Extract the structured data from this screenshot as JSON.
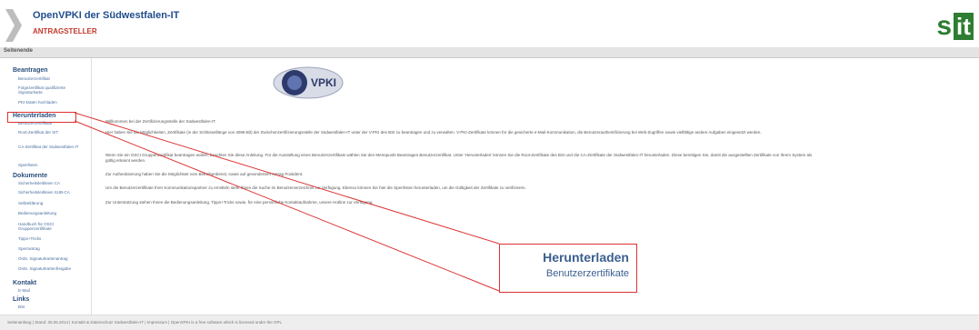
{
  "header": {
    "site_title": "OpenVPKI der Südwestfalen-IT",
    "role": "ANTRAGSTELLER",
    "logo_text": "sit"
  },
  "subbar": {
    "label": "Seitenende"
  },
  "sidebar": {
    "groups": [
      {
        "label": "Beantragen",
        "items": [
          "Benutzerzertifikat",
          "Folgezertifikat qualifizierte Signaturkarte",
          "PKI-Daten hochladen"
        ]
      },
      {
        "label": "Herunterladen",
        "items": [
          "Benutzerzertifikate",
          "Root-Zertifikat der SIT",
          "CA-Zertifikat der Südwestfalen-IT",
          "Sperrlisten"
        ]
      },
      {
        "label": "Dokumente",
        "items": [
          "Sicherheitsleitlinien CA",
          "Sicherheitsleitlinien SUB-CA",
          "Selbstklärung",
          "Bedienungsanleitung",
          "Handbuch für OSCI Gruppenzertifikate",
          "Tipps+Tricks",
          "Sperrantrag",
          "Ordn. Signaturkartenantrag",
          "Ordn. Signaturkartenfreigabe"
        ]
      },
      {
        "label": "Kontakt",
        "items": [
          "E-Mail"
        ]
      },
      {
        "label": "Links",
        "items": [
          "BSI"
        ]
      }
    ]
  },
  "main": {
    "logo_text": "VPKI",
    "paragraphs": [
      "Willkommen bei der Zertifizierungsstelle der Südwestfalen-IT.",
      "Hier haben Sie die Möglichkeiten, Zertifikate (in der Schlüssellänge von 4096-Bit) der Zwischenzertifizierungsstelle der Südwestfalen-IT unter der V-PKI des BSI zu beantragen und zu verwalten. V-PKI-Zertifikate können für die gesicherte e-Mail-Kommunikation, die Benutzerauthentifizierung bei Web-Zugriffen sowie vielfältige andere Aufgaben eingesetzt werden.",
      "Wenn Sie ein OSCI Gruppenzertifikat beantragen wollen, beachten Sie diese Anleitung. Für die Ausstellung eines Benutzerzertifikats wählen Sie den Menüpunkt Beantragen Benutzerzertifikat. Unter 'Herunterladen' können Sie die Root-Zertifikate des BSI und die CA-Zertifikate der Südwestfalen-IT herunterladen. Diese benötigen Sie, damit die ausgestellten Zertifikate von Ihrem System als gültig erkannt werden.",
      "Zur Authentisierung haben Sie die Möglichkeit vom Betreiberdienst, sowie auf gesondertem Antrag Postident.",
      "Um die Benutzerzertifikate Ihrer Kommunikationspartner zu ermitteln steht Ihnen die Suche im Benutzerverzeichnis zur Verfügung. Ebenso können Sie hier die Sperrlisten herunterladen, um die Gültigkeit der Zertifikate zu verifizieren.",
      "Zur Unterstützung stehen Ihnen die Bedienungsanleitung, Tipps+Tricks sowie, für eine persönliche Kontaktaufnahme, unsere Hotline zur Verfügung."
    ]
  },
  "callout": {
    "heading": "Herunterladen",
    "subheading": "Benutzerzertifikate"
  },
  "footer": {
    "text": "Seitenanfang | Stand: 30.06.2014 | Kontakt & Datenschutz Südwestfalen-IT | Impressum | OpenXPKI is a free software which is licensed under the GPL"
  }
}
